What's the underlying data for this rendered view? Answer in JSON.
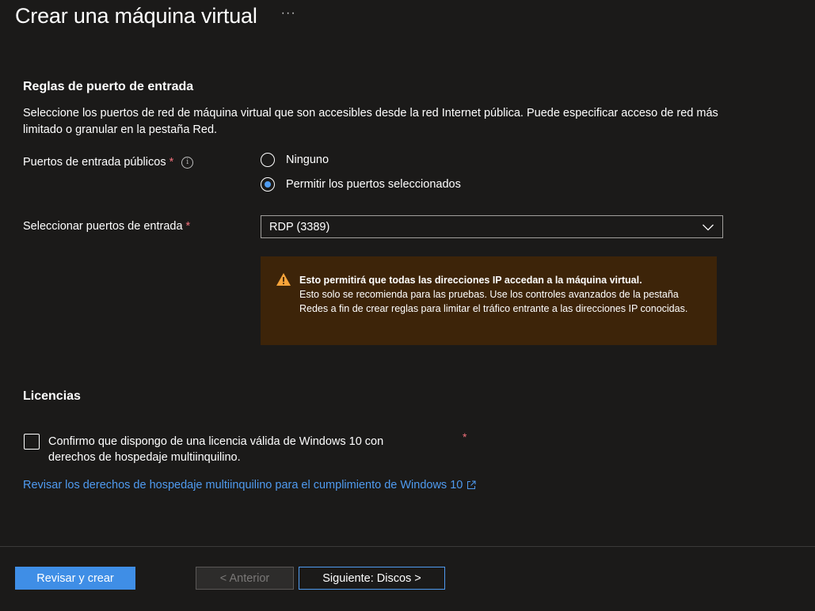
{
  "header": {
    "title": "Crear una máquina virtual",
    "more_label": "···"
  },
  "inbound": {
    "section_title": "Reglas de puerto de entrada",
    "description": "Seleccione los puertos de red de máquina virtual que son accesibles desde la red Internet pública. Puede especificar acceso de red más limitado o granular en la pestaña Red.",
    "public_ports_label": "Puertos de entrada públicos",
    "required_mark": "*",
    "info_glyph": "i",
    "radio_options": [
      {
        "label": "Ninguno",
        "selected": false
      },
      {
        "label": "Permitir los puertos seleccionados",
        "selected": true
      }
    ],
    "select_ports_label": "Seleccionar puertos de entrada",
    "select_ports_value": "RDP (3389)",
    "warning": {
      "bold": "Esto permitirá que todas las direcciones IP accedan a la máquina virtual.",
      "text": " Esto solo se recomienda para las pruebas.  Use los controles avanzados de la pestaña Redes a fin de crear reglas para limitar el tráfico entrante a las direcciones IP conocidas."
    }
  },
  "licensing": {
    "section_title": "Licencias",
    "checkbox_label": "Confirmo que dispongo de una licencia válida de Windows 10 con derechos de hospedaje multiinquilino.",
    "checkbox_checked": false,
    "required_mark": "*",
    "link_text": "Revisar los derechos de hospedaje multiinquilino para el cumplimiento de Windows 10"
  },
  "footer": {
    "review_button": "Revisar y crear",
    "previous_button": "< Anterior",
    "next_button": "Siguiente: Discos >"
  },
  "colors": {
    "background": "#1b1a19",
    "accent": "#4f9bf0",
    "primary_button": "#3f8ee6",
    "warning_background": "#3d2409",
    "warning_icon": "#f7a43a",
    "required": "#f1707b"
  },
  "icons": {
    "info": "info-icon",
    "chevron": "chevron-down-icon",
    "warning": "warning-icon",
    "external": "external-link-icon"
  }
}
